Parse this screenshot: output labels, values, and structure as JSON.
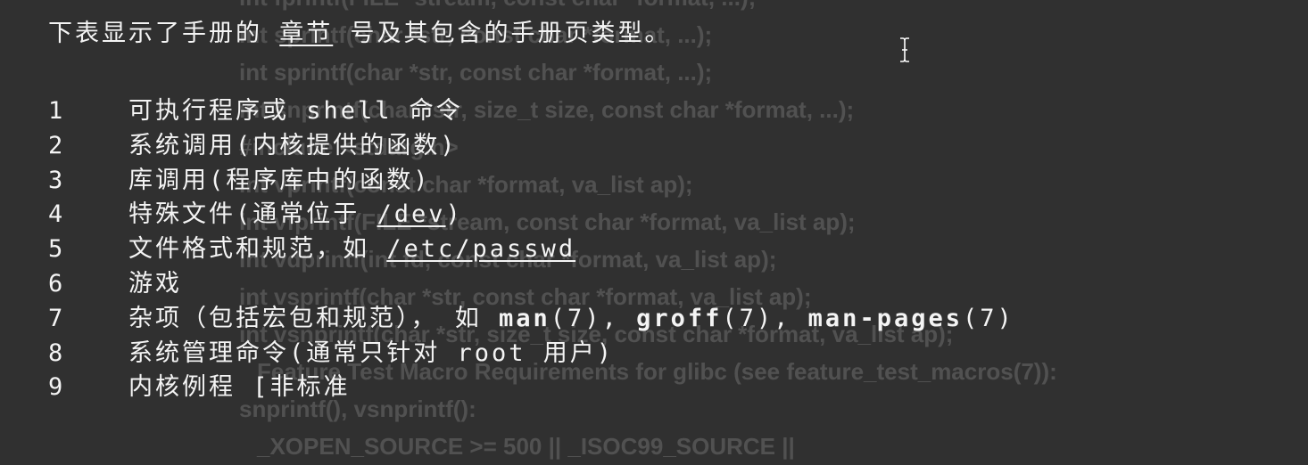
{
  "background_code": [
    "int fprintf(FILE *stream, const char *format, ...);",
    "int sprintf(char *str, const char *format, ...);",
    "int sprintf(char *str, const char *format, ...);",
    "int snprintf(char *str, size_t size, const char *format, ...);",
    "#include <stdarg.h>",
    "int vprintf(const char *format, va_list ap);",
    "int vfprintf(FILE *stream, const char *format, va_list ap);",
    "int vdprintf(int fd, const char *format, va_list ap);",
    "int vsprintf(char *str, const char *format, va_list ap);",
    "int vsnprintf(char *str, size_t size, const char *format, va_list ap);",
    "Feature Test Macro Requirements for glibc (see feature_test_macros(7)):",
    "snprintf(), vsnprintf():",
    "_XOPEN_SOURCE >= 500 || _ISOC99_SOURCE ||"
  ],
  "intro": {
    "before": "下表显示了手册的 ",
    "link": "章节",
    "after": " 号及其包含的手册页类型。"
  },
  "sections": [
    {
      "num": "1",
      "text": "可执行程序或 shell 命令"
    },
    {
      "num": "2",
      "text": "系统调用(内核提供的函数)"
    },
    {
      "num": "3",
      "text": "库调用(程序库中的函数)"
    },
    {
      "num": "4",
      "text": "特殊文件(通常位于 ",
      "link": "/dev",
      "after": ")"
    },
    {
      "num": "5",
      "text": "文件格式和规范，如 ",
      "link": "/etc/passwd"
    },
    {
      "num": "6",
      "text": "游戏"
    },
    {
      "num": "7",
      "text": "杂项（包括宏包和规范）， 如 ",
      "refs": [
        {
          "name": "man",
          "section": "(7)",
          "sep": ", "
        },
        {
          "name": "groff",
          "section": "(7)",
          "sep": ", "
        },
        {
          "name": "man-pages",
          "section": "(7)",
          "sep": ""
        }
      ]
    },
    {
      "num": "8",
      "text": "系统管理命令(通常只针对 root 用户)"
    },
    {
      "num": "9",
      "text": "内核例程 [非标准"
    }
  ]
}
